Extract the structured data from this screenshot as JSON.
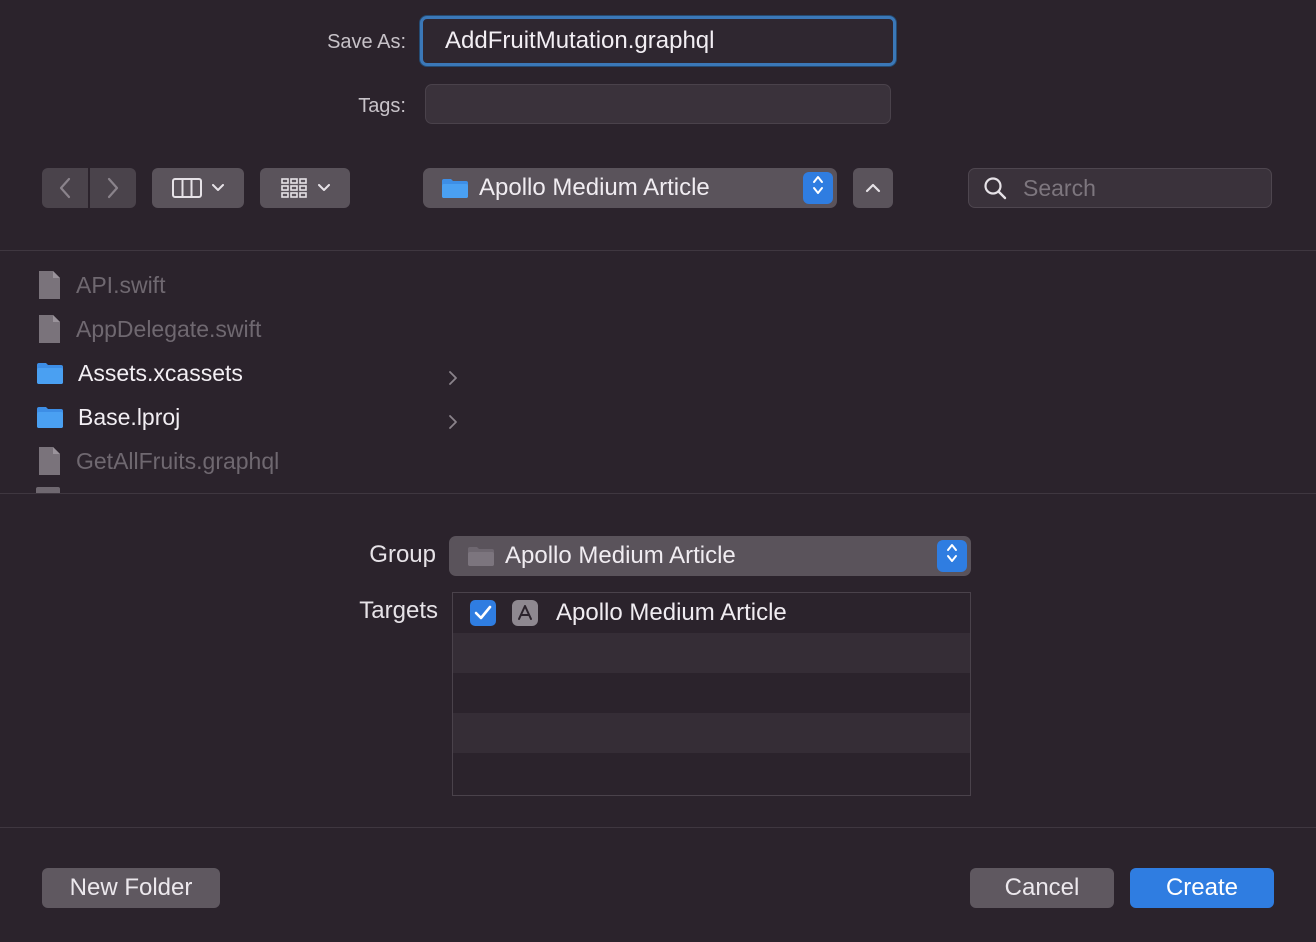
{
  "save_as": {
    "label": "Save As:",
    "value": "AddFruitMutation.graphql"
  },
  "tags": {
    "label": "Tags:",
    "value": ""
  },
  "toolbar": {
    "back_icon": "chevron-left-icon",
    "forward_icon": "chevron-right-icon",
    "column_view_icon": "column-view-icon",
    "group_icon": "grid-icon",
    "location": "Apollo Medium Article",
    "expand_icon": "chevron-up-icon"
  },
  "search": {
    "placeholder": "Search"
  },
  "files": [
    {
      "name": "API.swift",
      "kind": "file",
      "enabled": false
    },
    {
      "name": "AppDelegate.swift",
      "kind": "file",
      "enabled": false
    },
    {
      "name": "Assets.xcassets",
      "kind": "folder",
      "enabled": true
    },
    {
      "name": "Base.lproj",
      "kind": "folder",
      "enabled": true
    },
    {
      "name": "GetAllFruits.graphql",
      "kind": "file",
      "enabled": false
    }
  ],
  "group": {
    "label": "Group",
    "value": "Apollo Medium Article"
  },
  "targets": {
    "label": "Targets",
    "items": [
      {
        "name": "Apollo Medium Article",
        "checked": true
      }
    ]
  },
  "buttons": {
    "new_folder": "New Folder",
    "cancel": "Cancel",
    "create": "Create"
  },
  "colors": {
    "accent": "#2f7de1",
    "background": "#2b232c",
    "focus_ring": "#3b78b8"
  }
}
